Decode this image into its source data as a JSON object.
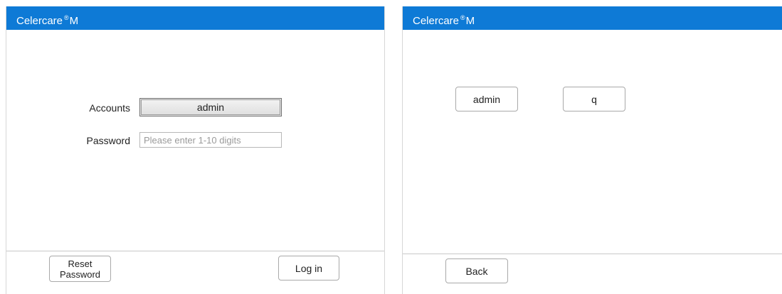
{
  "left_screen": {
    "title": {
      "brand": "Celercare",
      "reg": "®",
      "model": "M"
    },
    "accounts_label": "Accounts",
    "account_value": "admin",
    "password_label": "Password",
    "password_placeholder": "Please enter 1-10 digits",
    "reset_line1": "Reset",
    "reset_line2": "Password",
    "login_label": "Log in"
  },
  "right_screen": {
    "title": {
      "brand": "Celercare",
      "reg": "®",
      "model": "M"
    },
    "account_options": [
      "admin",
      "q"
    ],
    "back_label": "Back"
  }
}
